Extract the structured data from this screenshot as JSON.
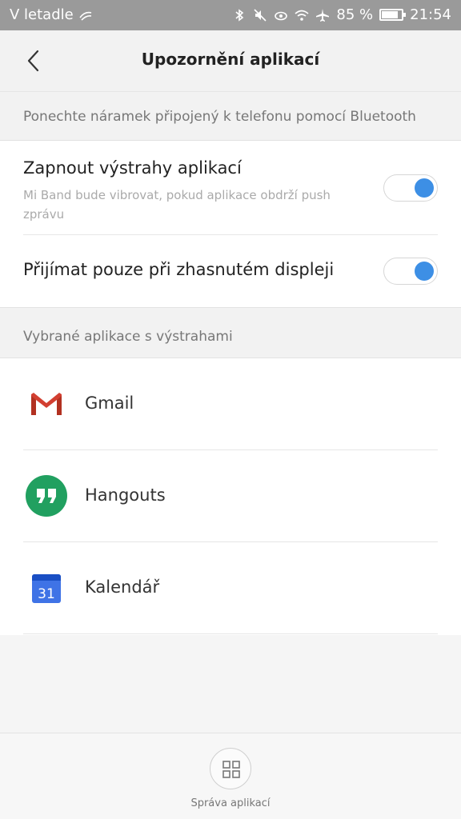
{
  "status_bar": {
    "carrier": "V letadle",
    "battery": "85 %",
    "battery_level": 0.85,
    "time": "21:54",
    "icons": [
      "bluetooth-icon",
      "mute-icon",
      "eye-icon",
      "wifi-icon",
      "airplane-icon",
      "battery-icon"
    ]
  },
  "header": {
    "title": "Upozornění aplikací",
    "back_icon": "chevron-left-icon"
  },
  "bluetooth_note": "Ponechte náramek připojený k telefonu pomocí Bluetooth",
  "settings": {
    "alerts": {
      "title": "Zapnout výstrahy aplikací",
      "description": "Mi Band bude vibrovat, pokud aplikace obdrží push zprávu",
      "enabled": true
    },
    "screen_off": {
      "title": "Přijímat pouze při zhasnutém displeji",
      "enabled": true
    }
  },
  "apps_note": "Vybrané aplikace s výstrahami",
  "apps": [
    {
      "label": "Gmail",
      "icon": "gmail-icon"
    },
    {
      "label": "Hangouts",
      "icon": "hangouts-icon"
    },
    {
      "label": "Kalendář",
      "icon": "calendar-icon",
      "icon_text": "31"
    }
  ],
  "bottom": {
    "manage_label": "Správa aplikací",
    "manage_icon": "grid-icon"
  },
  "colors": {
    "accent": "#3d8fe5",
    "hangouts_green": "#21a060",
    "gmail_red": "#d23f31",
    "calendar_blue": "#3f73e6"
  }
}
